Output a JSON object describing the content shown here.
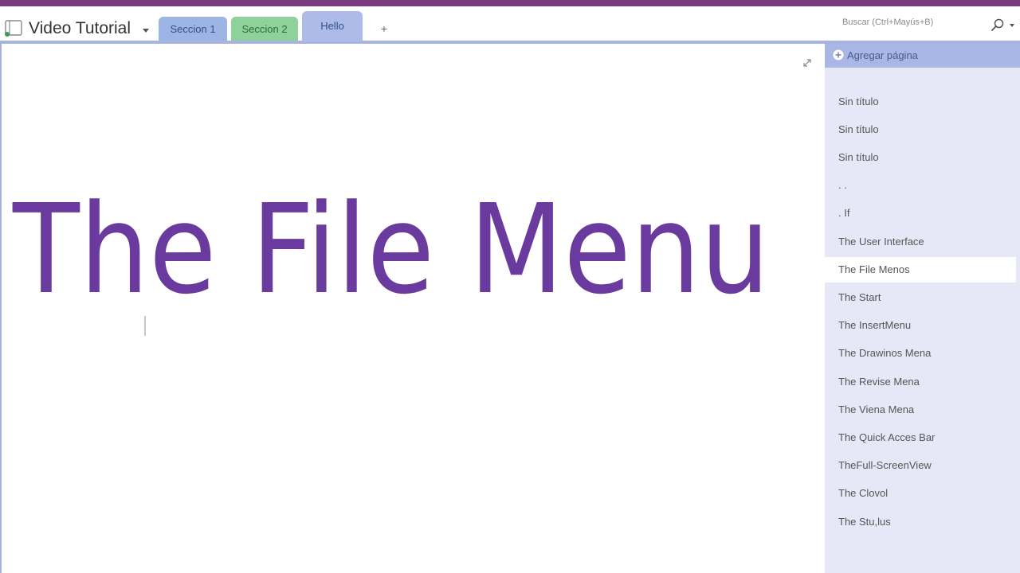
{
  "notebook": {
    "title": "Video Tutorial"
  },
  "tabs": [
    {
      "label": "Seccion 1"
    },
    {
      "label": "Seccion 2"
    },
    {
      "label": "Hello"
    }
  ],
  "add_tab_label": "+",
  "search": {
    "placeholder": "Buscar (Ctrl+Mayús+B)"
  },
  "canvas": {
    "ink_text": "The File Menu"
  },
  "pages": {
    "add_label": "Agregar página",
    "items": [
      {
        "label": "Sin título"
      },
      {
        "label": "Sin título"
      },
      {
        "label": "Sin título"
      },
      {
        "label": ". ."
      },
      {
        "label": ". If"
      },
      {
        "label": "The User Interface"
      },
      {
        "label": "The File Menos",
        "selected": true
      },
      {
        "label": "The Start"
      },
      {
        "label": "The InsertMenu"
      },
      {
        "label": "The Drawinos Mena"
      },
      {
        "label": "The Revise Mena"
      },
      {
        "label": "The Viena Mena"
      },
      {
        "label": "The Quick Acces Bar"
      },
      {
        "label": "TheFull-ScreenView"
      },
      {
        "label": "The Clovol"
      },
      {
        "label": "The Stu,lus"
      }
    ]
  },
  "colors": {
    "accent": "#7a3b7f",
    "ink": "#6a3a9e",
    "tab1": "#9cb5e4",
    "tab2": "#8fd19a",
    "tab3": "#aebbe9",
    "pane": "#e6e8f8"
  }
}
